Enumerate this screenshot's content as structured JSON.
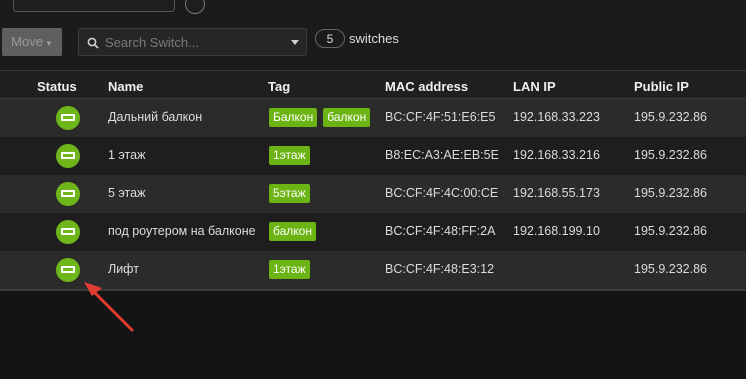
{
  "toolbar": {
    "move_label": "Move",
    "search_placeholder": "Search Switch...",
    "count": "5",
    "count_suffix": "switches"
  },
  "table": {
    "columns": [
      "Status",
      "Name",
      "Tag",
      "MAC address",
      "LAN IP",
      "Public IP"
    ],
    "rows": [
      {
        "status": "online",
        "name": "Дальний балкон",
        "tags": [
          "Балкон",
          "балкон"
        ],
        "mac": "BC:CF:4F:51:E6:E5",
        "lan": "192.168.33.223",
        "public": "195.9.232.86"
      },
      {
        "status": "online",
        "name": "1 этаж",
        "tags": [
          "1этаж"
        ],
        "mac": "B8:EC:A3:AE:EB:5E",
        "lan": "192.168.33.216",
        "public": "195.9.232.86"
      },
      {
        "status": "online",
        "name": "5 этаж",
        "tags": [
          "5этаж"
        ],
        "mac": "BC:CF:4F:4C:00:CE",
        "lan": "192.168.55.173",
        "public": "195.9.232.86"
      },
      {
        "status": "online",
        "name": "под роутером на балконе",
        "tags": [
          "балкон"
        ],
        "mac": "BC:CF:4F:48:FF:2A",
        "lan": "192.168.199.10",
        "public": "195.9.232.86"
      },
      {
        "status": "online",
        "name": "Лифт",
        "tags": [
          "1этаж"
        ],
        "mac": "BC:CF:4F:48:E3:12",
        "lan": "",
        "public": "195.9.232.86"
      }
    ]
  },
  "colors": {
    "accent_green": "#6cb414",
    "annotation_arrow": "#e03c31"
  }
}
